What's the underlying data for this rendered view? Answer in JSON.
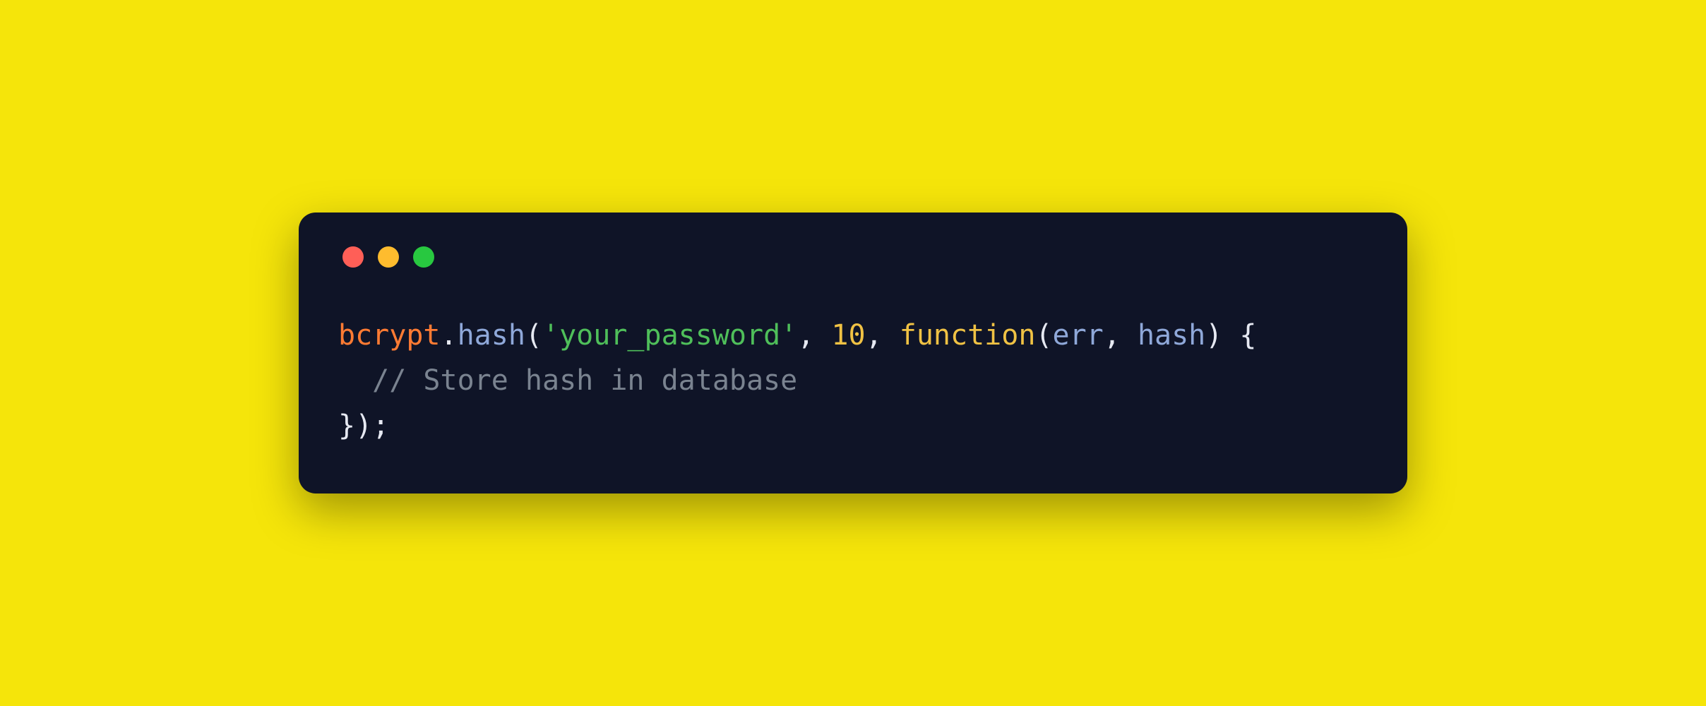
{
  "colors": {
    "background": "#f5e50a",
    "window_bg": "#0f1427",
    "traffic_red": "#ff5f57",
    "traffic_yellow": "#febc2e",
    "traffic_green": "#28c840",
    "ident": "#ff7b33",
    "punct": "#e6e9f2",
    "method": "#8fa8d9",
    "string": "#4fbf5a",
    "number": "#f0c244",
    "keyword": "#f0c244",
    "param": "#8fa8d9",
    "comment": "#7a8390"
  },
  "code": {
    "line1": {
      "t0": "bcrypt",
      "t1": ".",
      "t2": "hash",
      "t3": "(",
      "t4": "'your_password'",
      "t5": ", ",
      "t6": "10",
      "t7": ", ",
      "t8": "function",
      "t9": "(",
      "t10": "err",
      "t11": ", ",
      "t12": "hash",
      "t13": ") {"
    },
    "line2": {
      "indent": "  ",
      "comment": "// Store hash in database"
    },
    "line3": {
      "t0": "});"
    }
  }
}
